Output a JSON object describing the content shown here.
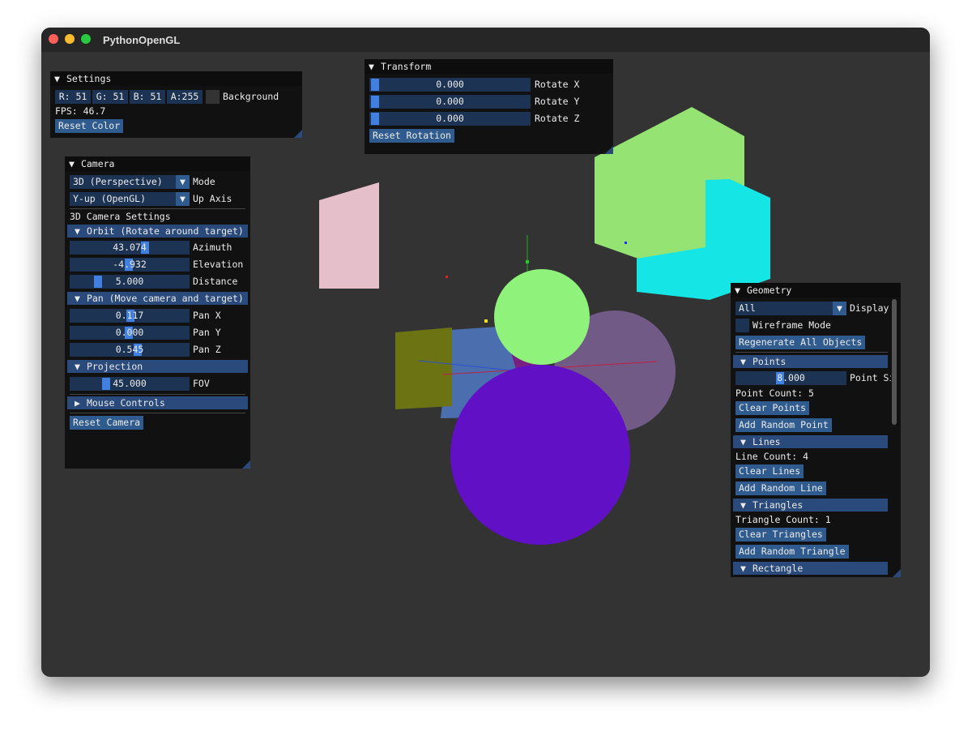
{
  "window": {
    "title": "PythonOpenGL"
  },
  "colors": {
    "background": "#333333",
    "title_active": "#294a7a",
    "frame": "#1c3353",
    "button": "#2f5b8f",
    "grab": "#4280e0"
  },
  "settings": {
    "title": "Settings",
    "r": "R: 51",
    "g": "G: 51",
    "b": "B: 51",
    "a": "A:255",
    "bg_label": "Background",
    "fps": "FPS: 46.7",
    "reset": "Reset Color"
  },
  "transform": {
    "title": "Transform",
    "rotate_x": {
      "value": "0.000",
      "label": "Rotate X"
    },
    "rotate_y": {
      "value": "0.000",
      "label": "Rotate Y"
    },
    "rotate_z": {
      "value": "0.000",
      "label": "Rotate Z"
    },
    "reset": "Reset Rotation"
  },
  "camera": {
    "title": "Camera",
    "mode": {
      "value": "3D (Perspective)",
      "label": "Mode"
    },
    "up_axis": {
      "value": "Y-up (OpenGL)",
      "label": "Up Axis"
    },
    "settings_text": "3D Camera Settings",
    "orbit_header": "Orbit (Rotate around target)",
    "azimuth": {
      "value": "43.074",
      "label": "Azimuth"
    },
    "elevation": {
      "value": "-4.932",
      "label": "Elevation"
    },
    "distance": {
      "value": "5.000",
      "label": "Distance"
    },
    "pan_header": "Pan (Move camera and target)",
    "pan_x": {
      "value": "0.117",
      "label": "Pan X"
    },
    "pan_y": {
      "value": "0.000",
      "label": "Pan Y"
    },
    "pan_z": {
      "value": "0.545",
      "label": "Pan Z"
    },
    "projection_header": "Projection",
    "fov": {
      "value": "45.000",
      "label": "FOV"
    },
    "mouse_header": "Mouse Controls",
    "reset": "Reset Camera"
  },
  "geometry": {
    "title": "Geometry",
    "display": {
      "value": "All",
      "label": "Display"
    },
    "wireframe_label": "Wireframe Mode",
    "regenerate": "Regenerate All Objects",
    "points_header": "Points",
    "point_size": {
      "value": "8.000",
      "label": "Point Si"
    },
    "point_count": "Point Count: 5",
    "clear_points": "Clear Points",
    "add_point": "Add Random Point",
    "lines_header": "Lines",
    "line_count": "Line Count: 4",
    "clear_lines": "Clear Lines",
    "add_line": "Add Random Line",
    "triangles_header": "Triangles",
    "triangle_count": "Triangle Count: 1",
    "clear_triangles": "Clear Triangles",
    "add_triangle": "Add Random Triangle",
    "rectangle_header": "Rectangle"
  }
}
